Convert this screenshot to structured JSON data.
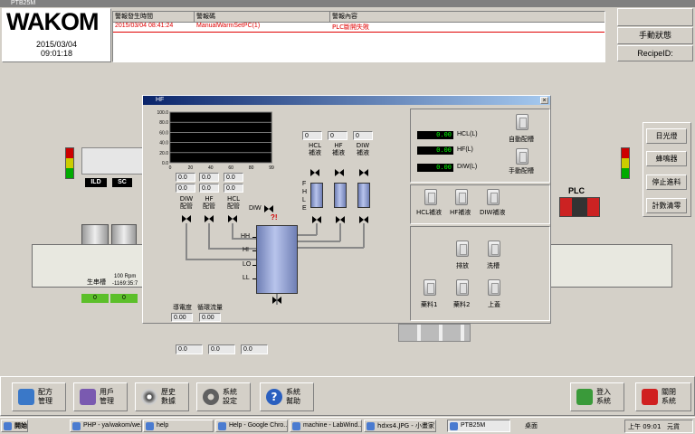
{
  "window": {
    "title": "PTB25M"
  },
  "header": {
    "logo": "WAKOM",
    "date": "2015/03/04",
    "time": "09:01:18",
    "alarm_columns": [
      "警報發生時間",
      "警報碼",
      "警報內容"
    ],
    "alarm_rows": [
      {
        "time": "2015/03/04 08:41:24",
        "code": "ManualWarmSetPC(1)",
        "content": "PLC斷開失敗"
      }
    ],
    "mode": "手動狀態",
    "recipe_label": "RecipeID:"
  },
  "side_buttons": [
    "日光燈",
    "蜂鳴器",
    "停止進料",
    "計數清零"
  ],
  "plc_label": "PLC",
  "background_labels": {
    "ild": "ILD",
    "sc": "SC",
    "station": "生串槽",
    "rpm": "100 Rpm",
    "counter": "-1169:35:7",
    "zero1": "0",
    "zero2": "0"
  },
  "dialog": {
    "title": "HF",
    "chart": {
      "y_ticks": [
        "100.0",
        "80.0",
        "60.0",
        "40.0",
        "20.0",
        "0.0"
      ],
      "x_ticks": [
        "0",
        "20",
        "40",
        "60",
        "80",
        "99"
      ]
    },
    "left_values": [
      "0.0",
      "0.0",
      "0.0",
      "0.0",
      "0.0",
      "0.0"
    ],
    "left_labels": [
      "DIW\n配管",
      "HF\n配管",
      "HCL\n配管"
    ],
    "dose_values": [
      "0",
      "0",
      "0"
    ],
    "dose_labels": [
      "HCL\n補液",
      "HF\n補液",
      "DIW\n補液"
    ],
    "level_labels": [
      "F",
      "H",
      "L",
      "E"
    ],
    "main_tank_levels": [
      "HH",
      "HI",
      "LO",
      "LL"
    ],
    "diw_label": "DIW",
    "alarm_mark": "?!",
    "conductivity_label": "導電度",
    "flow_label": "循環流量",
    "conductivity_value": "0.00",
    "flow_value": "0.00",
    "readouts": [
      {
        "value": "0.00",
        "label": "HCL(L)"
      },
      {
        "value": "0.00",
        "label": "HF(L)"
      },
      {
        "value": "0.00",
        "label": "DIW(L)"
      }
    ],
    "top_buttons": [
      "自動配槽",
      "手動配槽"
    ],
    "fill_buttons": [
      "HCL補液",
      "HF補液",
      "DIW補液"
    ],
    "action_buttons": [
      "排放",
      "洗槽",
      "藥料1",
      "藥料2",
      "上蓋"
    ]
  },
  "below_values": [
    "0.0",
    "0.0",
    "0.0"
  ],
  "bottom_buttons": [
    {
      "label": "配方\n管理",
      "color": "#3a78c8"
    },
    {
      "label": "用戶\n管理",
      "color": "#7a5ab0"
    },
    {
      "label": "歷史\n數據",
      "color": "#404040"
    },
    {
      "label": "系統\n設定",
      "color": "#606060"
    },
    {
      "label": "系統\n幫助",
      "color": "#2a5fbf"
    }
  ],
  "login_button": "登入\n系統",
  "exit_button": "關閉\n系統",
  "taskbar": {
    "start": "開始",
    "items": [
      "PHP - ya/wakom/we...",
      "help",
      "Help - Google Chro...",
      "machine - LabWind...",
      "hdxs4.JPG - 小畫家",
      "PTB25M"
    ],
    "desktop": "桌面",
    "clock": "上午 09:01",
    "ime": "元貨"
  }
}
